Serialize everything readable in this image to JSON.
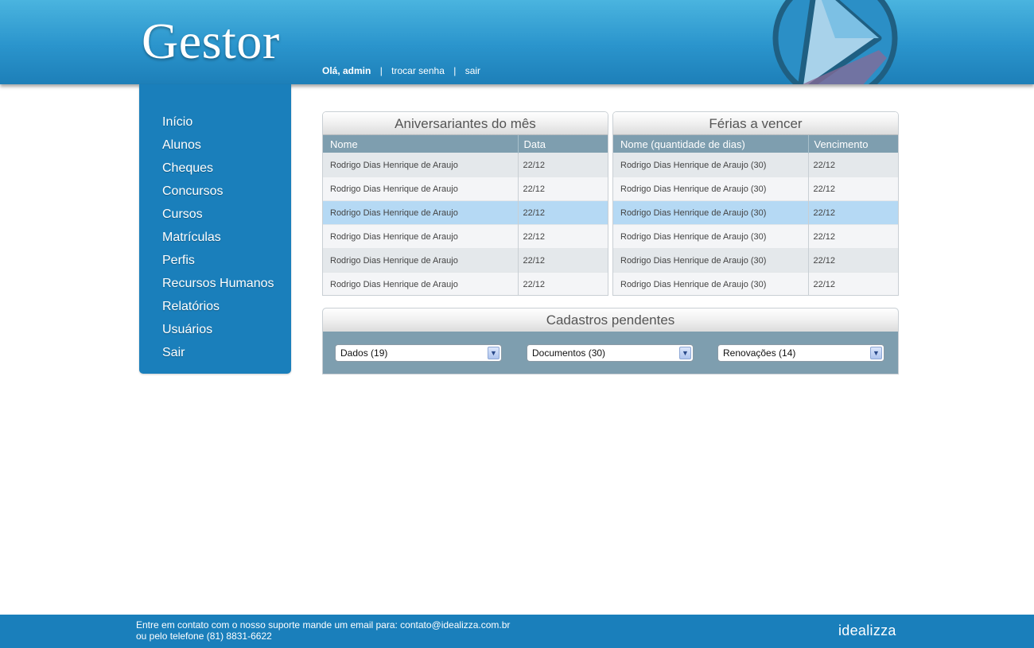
{
  "header": {
    "logo": "Gestor",
    "greeting": "Olá, admin",
    "separator": "|",
    "change_password": "trocar senha",
    "logout": "sair"
  },
  "sidebar": {
    "items": [
      {
        "label": "Início"
      },
      {
        "label": "Alunos"
      },
      {
        "label": "Cheques"
      },
      {
        "label": "Concursos"
      },
      {
        "label": "Cursos"
      },
      {
        "label": "Matrículas"
      },
      {
        "label": "Perfis"
      },
      {
        "label": "Recursos Humanos"
      },
      {
        "label": "Relatórios"
      },
      {
        "label": "Usuários"
      },
      {
        "label": "Sair"
      }
    ]
  },
  "birthdays": {
    "title": "Aniversariantes do mês",
    "columns": [
      "Nome",
      "Data"
    ],
    "rows": [
      {
        "name": "Rodrigo Dias Henrique de Araujo",
        "date": "22/12"
      },
      {
        "name": "Rodrigo Dias Henrique de Araujo",
        "date": "22/12"
      },
      {
        "name": "Rodrigo Dias Henrique de Araujo",
        "date": "22/12"
      },
      {
        "name": "Rodrigo Dias Henrique de Araujo",
        "date": "22/12"
      },
      {
        "name": "Rodrigo Dias Henrique de Araujo",
        "date": "22/12"
      },
      {
        "name": "Rodrigo Dias Henrique de Araujo",
        "date": "22/12"
      }
    ]
  },
  "vacations": {
    "title": "Férias a vencer",
    "columns": [
      "Nome (quantidade de dias)",
      "Vencimento"
    ],
    "rows": [
      {
        "name": "Rodrigo Dias Henrique de Araujo (30)",
        "due": "22/12"
      },
      {
        "name": "Rodrigo Dias Henrique de Araujo (30)",
        "due": "22/12"
      },
      {
        "name": "Rodrigo Dias Henrique de Araujo (30)",
        "due": "22/12"
      },
      {
        "name": "Rodrigo Dias Henrique de Araujo (30)",
        "due": "22/12"
      },
      {
        "name": "Rodrigo Dias Henrique de Araujo (30)",
        "due": "22/12"
      },
      {
        "name": "Rodrigo Dias Henrique de Araujo (30)",
        "due": "22/12"
      }
    ]
  },
  "pending": {
    "title": "Cadastros pendentes",
    "selects": [
      {
        "value": "Dados (19)"
      },
      {
        "value": "Documentos (30)"
      },
      {
        "value": "Renovações (14)"
      }
    ]
  },
  "footer": {
    "line1": "Entre em contato com o nosso suporte mande um email para: contato@idealizza.com.br",
    "line2": "ou pelo telefone (81) 8831-6622",
    "brand": "idealizza"
  },
  "icons": {
    "header_emblem": "play-triangle-emblem-icon",
    "select_arrow": "chevron-down-icon"
  },
  "colors": {
    "header_blue": "#2a94cc",
    "sidebar_blue": "#1a7fbb",
    "table_header": "#7e9eaf",
    "row_highlight": "#b5d9f4",
    "row_odd": "#e4e8eb",
    "row_even": "#f4f5f7"
  }
}
